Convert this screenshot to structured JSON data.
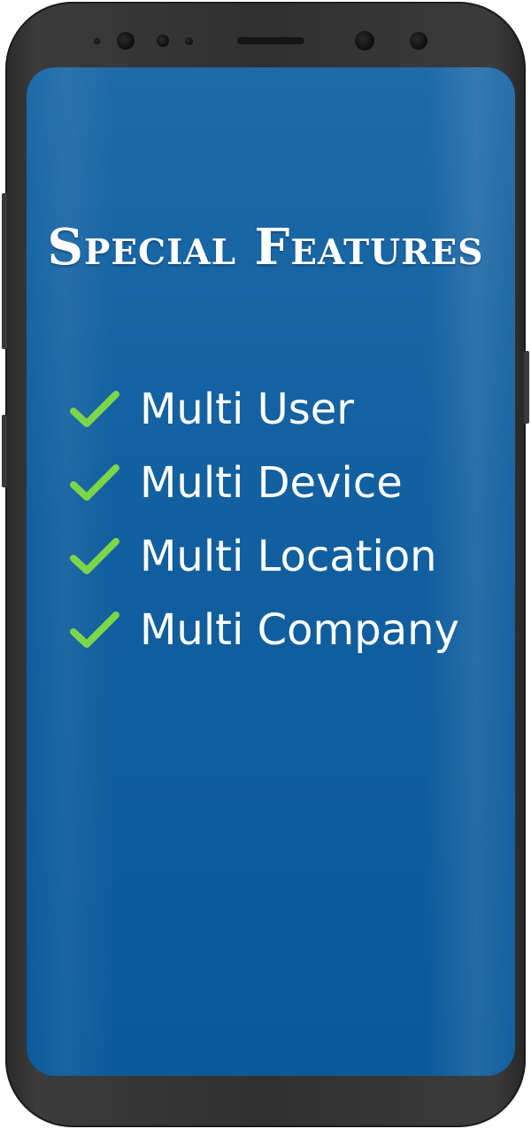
{
  "screen": {
    "title": "Special Features",
    "background_color": "#115f9f",
    "check_color": "#7cd64a"
  },
  "features": [
    {
      "label": "Multi User",
      "icon": "checkmark-icon"
    },
    {
      "label": "Multi Device",
      "icon": "checkmark-icon"
    },
    {
      "label": "Multi Location",
      "icon": "checkmark-icon"
    },
    {
      "label": "Multi Company",
      "icon": "checkmark-icon"
    }
  ]
}
